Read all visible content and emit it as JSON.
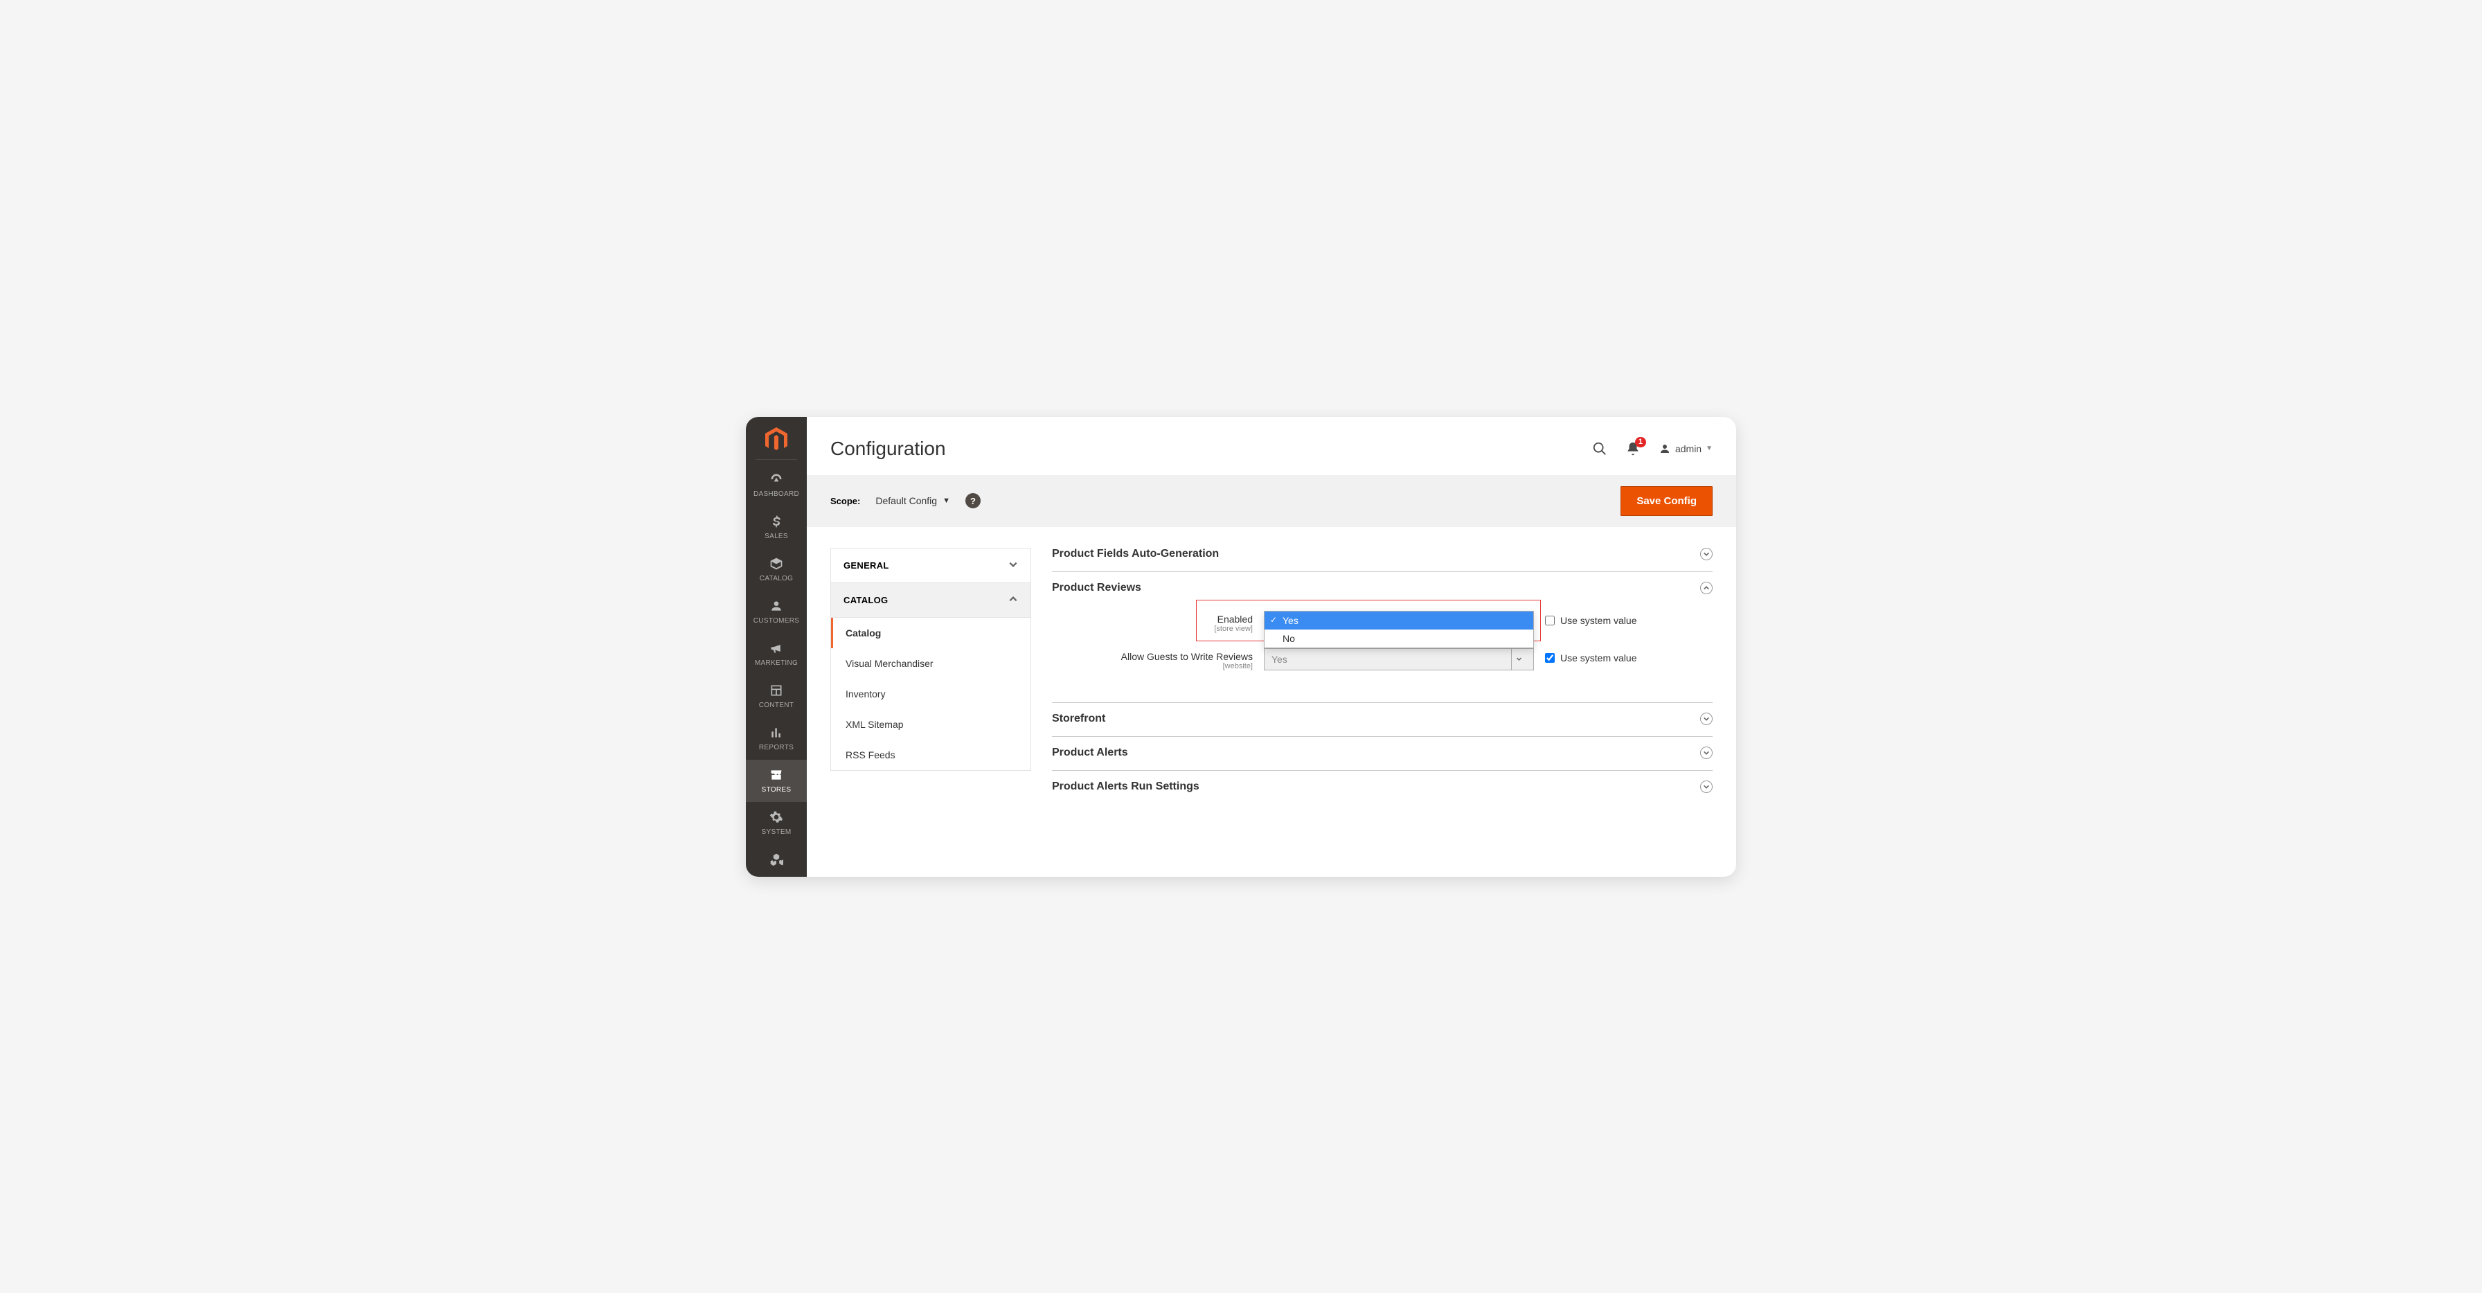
{
  "sidebar": {
    "items": [
      {
        "label": "DASHBOARD"
      },
      {
        "label": "SALES"
      },
      {
        "label": "CATALOG"
      },
      {
        "label": "CUSTOMERS"
      },
      {
        "label": "MARKETING"
      },
      {
        "label": "CONTENT"
      },
      {
        "label": "REPORTS"
      },
      {
        "label": "STORES"
      },
      {
        "label": "SYSTEM"
      }
    ]
  },
  "page_title": "Configuration",
  "notifications_count": "1",
  "user_name": "admin",
  "scope": {
    "label": "Scope:",
    "value": "Default Config"
  },
  "save_button": "Save Config",
  "config_tabs": {
    "general": "GENERAL",
    "catalog": "CATALOG",
    "catalog_sub": [
      {
        "label": "Catalog"
      },
      {
        "label": "Visual Merchandiser"
      },
      {
        "label": "Inventory"
      },
      {
        "label": "XML Sitemap"
      },
      {
        "label": "RSS Feeds"
      }
    ]
  },
  "sections": {
    "auto_gen": "Product Fields Auto-Generation",
    "reviews": "Product Reviews",
    "reviews_fields": {
      "enabled": {
        "label": "Enabled",
        "scope": "[store view]",
        "options": [
          "Yes",
          "No"
        ],
        "selected": "Yes"
      },
      "guests": {
        "label": "Allow Guests to Write Reviews",
        "scope": "[website]",
        "value": "Yes"
      }
    },
    "use_system": "Use system value",
    "storefront": "Storefront",
    "alerts": "Product Alerts",
    "alerts_run": "Product Alerts Run Settings"
  }
}
